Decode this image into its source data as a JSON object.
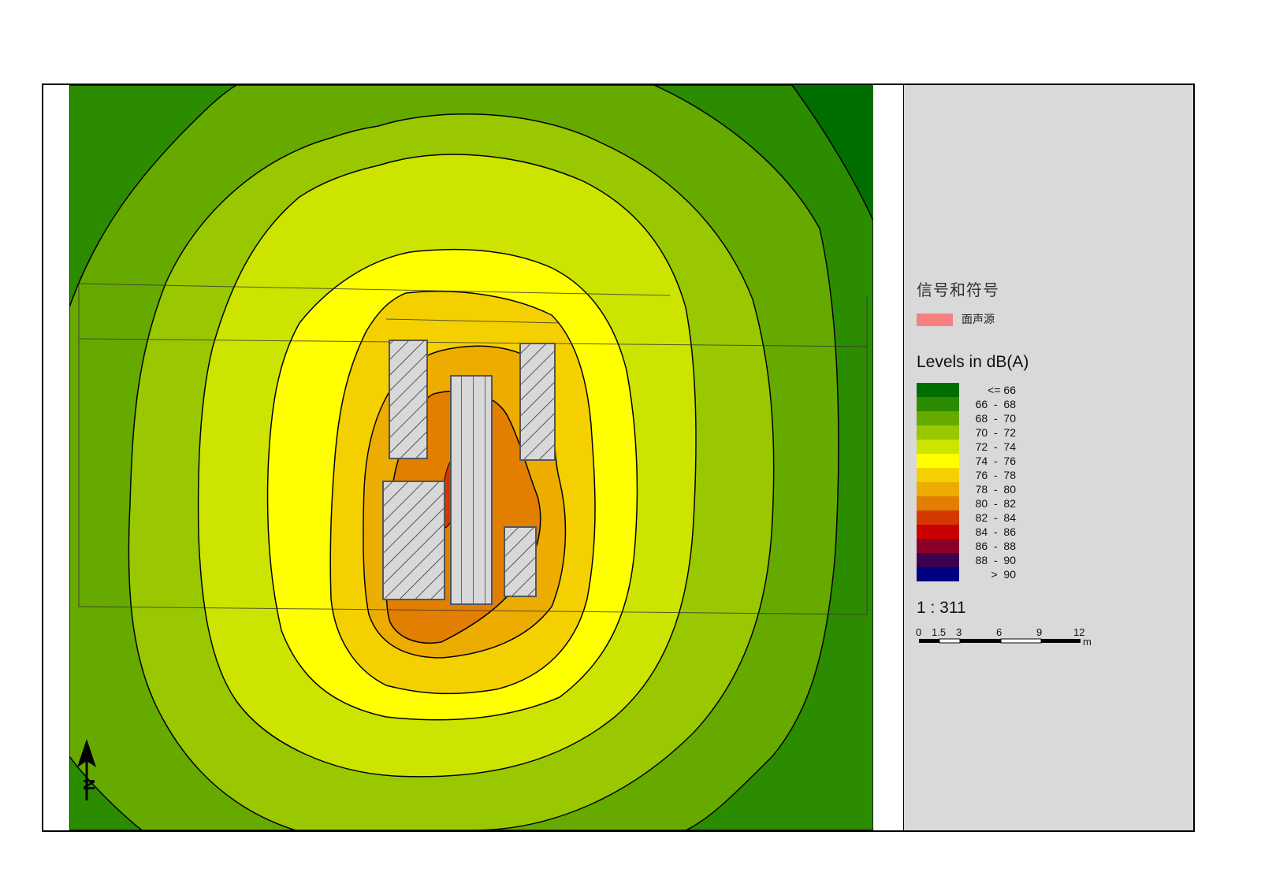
{
  "legend": {
    "title": "信号和符号",
    "area_source": {
      "label": "面声源",
      "color": "#f68080"
    },
    "levels_title": "Levels in dB(A)",
    "levels": [
      {
        "label": "<= 66",
        "color": "#006e00"
      },
      {
        "label": "66  -  68",
        "color": "#2c8c00"
      },
      {
        "label": "68  -  70",
        "color": "#66aa00"
      },
      {
        "label": "70  -  72",
        "color": "#99c800"
      },
      {
        "label": "72  -  74",
        "color": "#cce400"
      },
      {
        "label": "74  -  76",
        "color": "#ffff00"
      },
      {
        "label": "76  -  78",
        "color": "#f5d000"
      },
      {
        "label": "78  -  80",
        "color": "#edac00"
      },
      {
        "label": "80  -  82",
        "color": "#e27e00"
      },
      {
        "label": "82  -  84",
        "color": "#d43800"
      },
      {
        "label": "84  -  86",
        "color": "#c80000"
      },
      {
        "label": "86  -  88",
        "color": "#8c0028"
      },
      {
        "label": "88  -  90",
        "color": "#3c0050"
      },
      {
        "label": ">  90",
        "color": "#000080"
      }
    ]
  },
  "scale": {
    "ratio": "1 : 311",
    "ticks": [
      "0",
      "1.5",
      "3",
      "6",
      "9",
      "12"
    ],
    "unit": "m"
  },
  "north_arrow": {
    "letter": "N",
    "icon": "north-arrow-icon"
  },
  "map": {
    "buildings": [
      {
        "name": "building-a",
        "hatch": "diagonal"
      },
      {
        "name": "building-b",
        "hatch": "vertical"
      },
      {
        "name": "building-c",
        "hatch": "diagonal"
      },
      {
        "name": "building-d",
        "hatch": "diagonal"
      },
      {
        "name": "building-e",
        "hatch": "diagonal"
      }
    ]
  }
}
